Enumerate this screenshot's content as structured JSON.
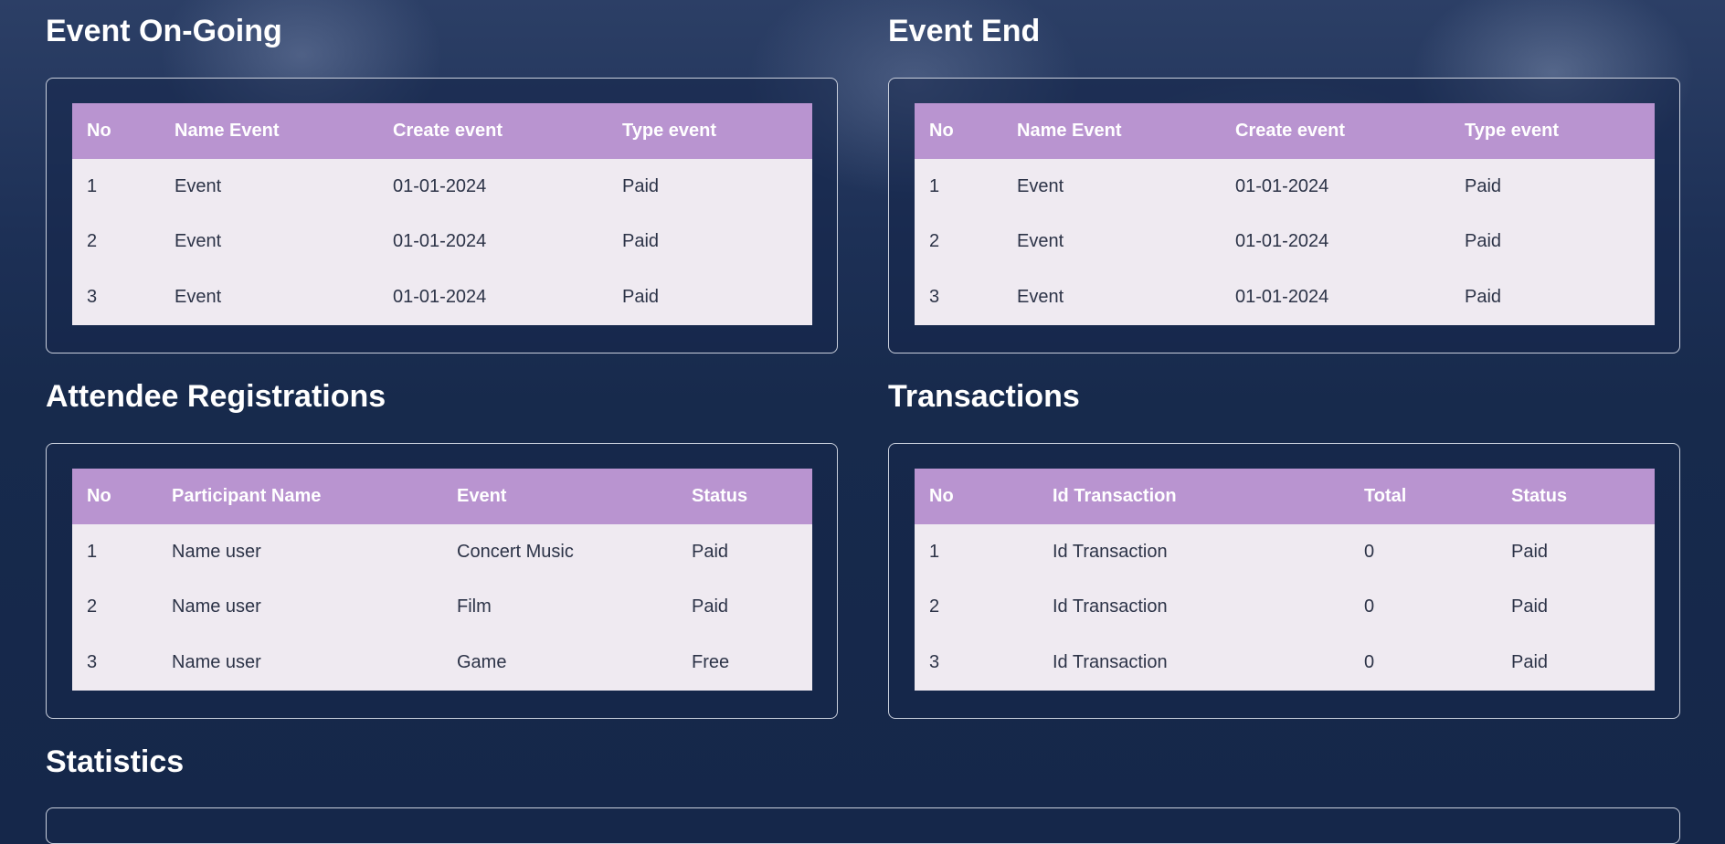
{
  "sections": {
    "ongoing": {
      "title": "Event On-Going",
      "headers": [
        "No",
        "Name Event",
        "Create event",
        "Type event"
      ],
      "rows": [
        [
          "1",
          "Event",
          "01-01-2024",
          "Paid"
        ],
        [
          "2",
          "Event",
          "01-01-2024",
          "Paid"
        ],
        [
          "3",
          "Event",
          "01-01-2024",
          "Paid"
        ]
      ]
    },
    "ended": {
      "title": "Event End",
      "headers": [
        "No",
        "Name Event",
        "Create event",
        "Type event"
      ],
      "rows": [
        [
          "1",
          "Event",
          "01-01-2024",
          "Paid"
        ],
        [
          "2",
          "Event",
          "01-01-2024",
          "Paid"
        ],
        [
          "3",
          "Event",
          "01-01-2024",
          "Paid"
        ]
      ]
    },
    "attendees": {
      "title": "Attendee Registrations",
      "headers": [
        "No",
        "Participant Name",
        "Event",
        "Status"
      ],
      "rows": [
        [
          "1",
          "Name user",
          "Concert Music",
          "Paid"
        ],
        [
          "2",
          "Name user",
          "Film",
          "Paid"
        ],
        [
          "3",
          "Name user",
          "Game",
          "Free"
        ]
      ]
    },
    "transactions": {
      "title": "Transactions",
      "headers": [
        "No",
        "Id Transaction",
        "Total",
        "Status"
      ],
      "rows": [
        [
          "1",
          "Id Transaction",
          "0",
          "Paid"
        ],
        [
          "2",
          "Id Transaction",
          "0",
          "Paid"
        ],
        [
          "3",
          "Id Transaction",
          "0",
          "Paid"
        ]
      ]
    },
    "statistics": {
      "title": "Statistics"
    }
  },
  "colors": {
    "background": "#15274a",
    "table_header": "#b994d0",
    "table_body": "#efeaf1",
    "table_text": "#2c3347",
    "title_text": "#ffffff"
  }
}
